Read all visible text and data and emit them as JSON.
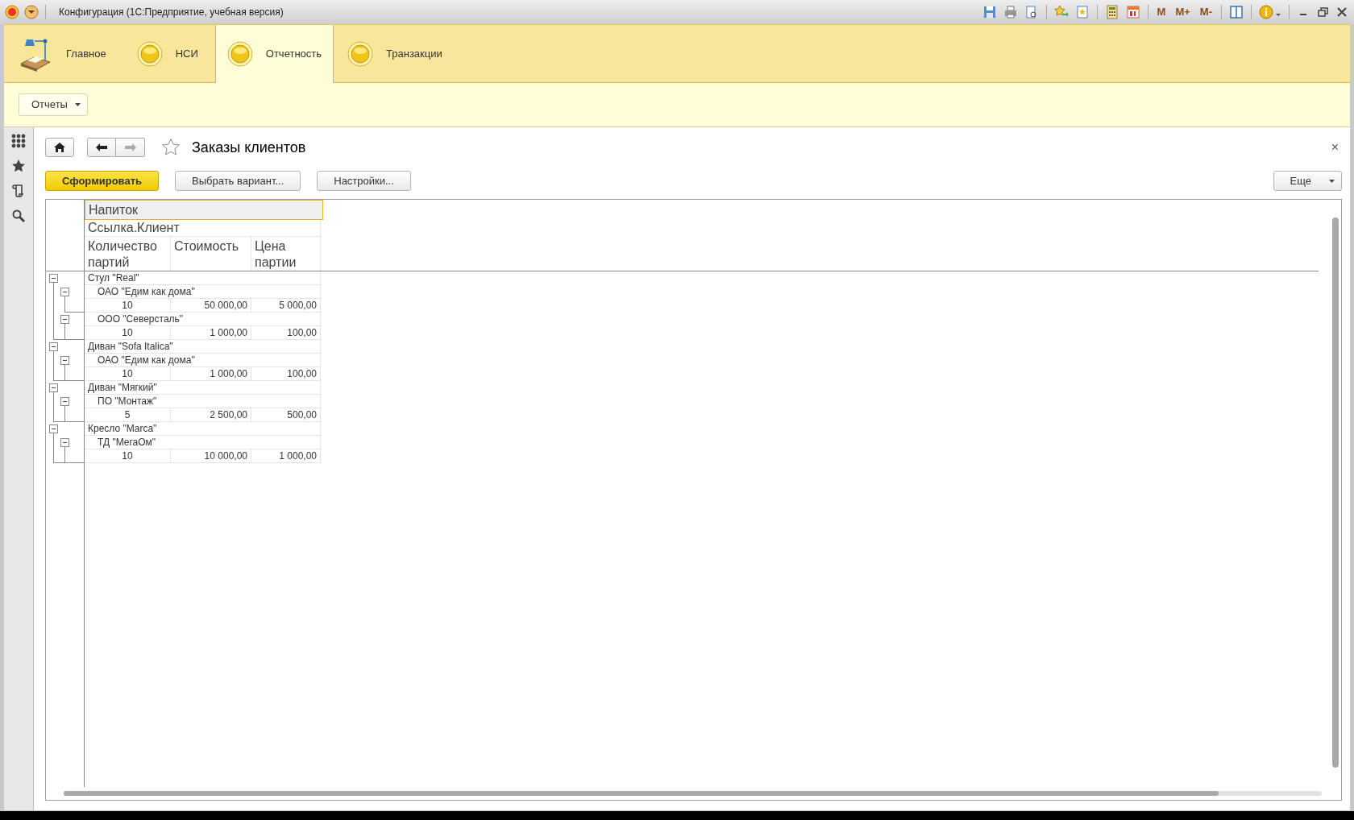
{
  "window": {
    "title": "Конфигурация  (1С:Предприятие, учебная версия)",
    "memory_buttons": [
      "M",
      "M+",
      "M-"
    ]
  },
  "sections": [
    {
      "label": "Главное",
      "kind": "lamp",
      "selected": false
    },
    {
      "label": "НСИ",
      "kind": "circle",
      "selected": false
    },
    {
      "label": "Отчетность",
      "kind": "circle",
      "selected": true
    },
    {
      "label": "Транзакции",
      "kind": "circle",
      "selected": false
    }
  ],
  "command_bar": {
    "menu": "Отчеты"
  },
  "form": {
    "title": "Заказы клиентов",
    "close": "×",
    "buttons": [
      {
        "label": "Сформировать",
        "kind": "primary"
      },
      {
        "label": "Выбрать вариант...",
        "kind": "plain"
      },
      {
        "label": "Настройки...",
        "kind": "plain"
      }
    ],
    "more": "Еще"
  },
  "report": {
    "header": {
      "group_1": "Напиток",
      "group_2": "Ссылка.Клиент",
      "columns": [
        "Количество партий",
        "Стоимость",
        "Цена партии"
      ]
    },
    "rows": [
      {
        "label": "Стул \"Real\"",
        "expanded": true,
        "children": [
          {
            "label": "ОАО \"Едим как дома\"",
            "expanded": true,
            "values": [
              "10",
              "50 000,00",
              "5 000,00"
            ]
          },
          {
            "label": "ООО \"Северсталь\"",
            "expanded": true,
            "values": [
              "10",
              "1 000,00",
              "100,00"
            ]
          }
        ]
      },
      {
        "label": "Диван \"Sofa Italica\"",
        "expanded": true,
        "children": [
          {
            "label": "ОАО \"Едим как дома\"",
            "expanded": true,
            "values": [
              "10",
              "1 000,00",
              "100,00"
            ]
          }
        ]
      },
      {
        "label": "Диван \"Мягкий\"",
        "expanded": true,
        "children": [
          {
            "label": "ПО \"Монтаж\"",
            "expanded": true,
            "values": [
              "5",
              "2 500,00",
              "500,00"
            ]
          }
        ]
      },
      {
        "label": "Кресло \"Marca\"",
        "expanded": true,
        "children": [
          {
            "label": "ТД \"МегаОм\"",
            "expanded": true,
            "values": [
              "10",
              "10 000,00",
              "1 000,00"
            ]
          }
        ]
      }
    ]
  }
}
